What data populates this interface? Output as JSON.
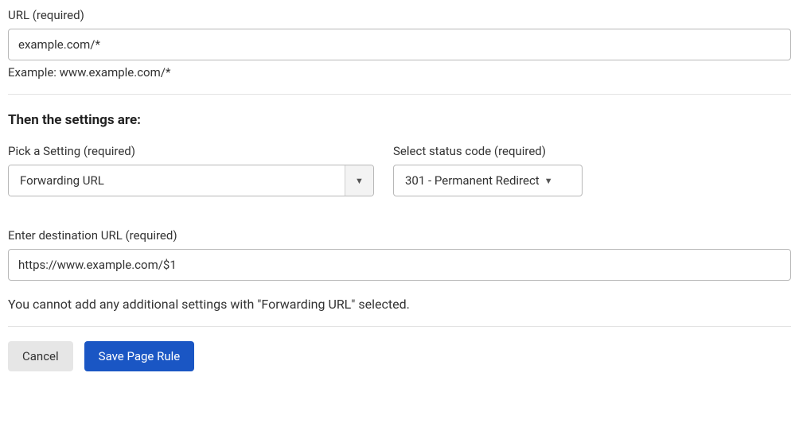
{
  "url_field": {
    "label": "URL (required)",
    "value": "example.com/*",
    "helper": "Example: www.example.com/*"
  },
  "section_heading": "Then the settings are:",
  "pick_setting": {
    "label": "Pick a Setting (required)",
    "value": "Forwarding URL"
  },
  "status_code": {
    "label": "Select status code (required)",
    "value": "301 - Permanent Redirect"
  },
  "destination": {
    "label": "Enter destination URL (required)",
    "value": "https://www.example.com/$1"
  },
  "info_text": "You cannot add any additional settings with \"Forwarding URL\" selected.",
  "buttons": {
    "cancel": "Cancel",
    "save": "Save Page Rule"
  }
}
